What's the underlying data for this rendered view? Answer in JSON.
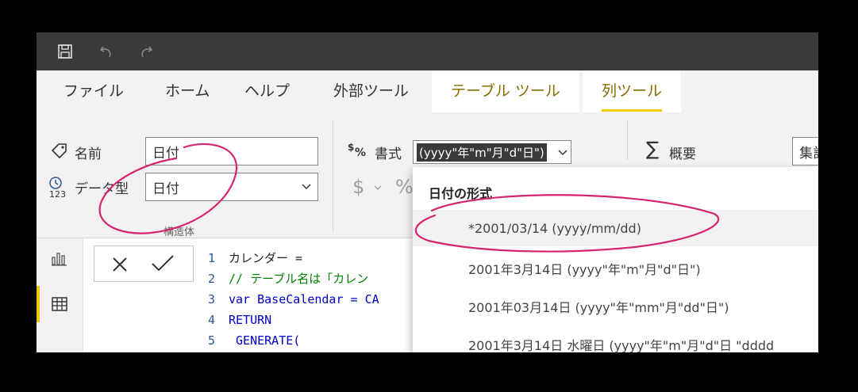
{
  "tabs": [
    "ファイル",
    "ホーム",
    "ヘルプ",
    "外部ツール",
    "テーブル ツール",
    "列ツール"
  ],
  "ribbon": {
    "name_label": "名前",
    "name_value": "日付",
    "datatype_label": "データ型",
    "datatype_value": "日付",
    "format_label": "書式",
    "format_value": "(yyyy\"年\"m\"月\"d\"日\")",
    "currency_symbol": "$",
    "percent_symbol": "%",
    "summary_label": "概要",
    "summary_value": "集計",
    "group_label": "構造体"
  },
  "formula": {
    "lines": [
      {
        "num": "1",
        "text": "カレンダー ="
      },
      {
        "num": "2",
        "text": "// テーブル名は「カレン"
      },
      {
        "num": "3",
        "text": "var BaseCalendar = CA"
      },
      {
        "num": "4",
        "text": "RETURN"
      },
      {
        "num": "5",
        "text": "    GENERATE("
      }
    ]
  },
  "dropdown": {
    "header": "日付の形式",
    "items": [
      "*2001/03/14 (yyyy/mm/dd)",
      "2001年3月14日 (yyyy\"年\"m\"月\"d\"日\")",
      "2001年03月14日 (yyyy\"年\"mm\"月\"dd\"日\")",
      "2001年3月14日 水曜日 (yyyy\"年\"m\"月\"d\"日 \"dddd"
    ]
  },
  "colors": {
    "titlebar": "#3b3a39",
    "ribbon": "#f3f2f1",
    "accent": "#f2c811",
    "ink": "#d6246e",
    "keyword": "#0000ff",
    "comment": "#008000"
  }
}
